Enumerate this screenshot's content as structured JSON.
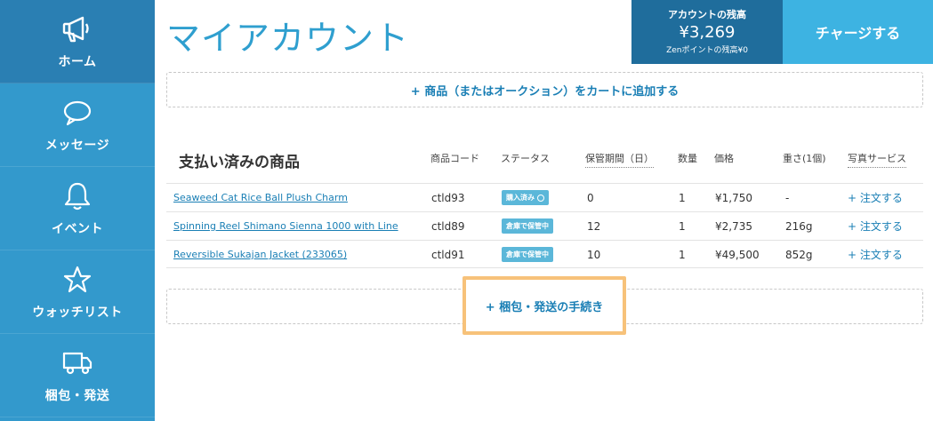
{
  "sidebar": {
    "items": [
      {
        "label": "ホーム",
        "icon": "megaphone-icon",
        "active": true
      },
      {
        "label": "メッセージ",
        "icon": "speech-bubble-icon"
      },
      {
        "label": "イベント",
        "icon": "bell-icon"
      },
      {
        "label": "ウォッチリスト",
        "icon": "star-icon"
      },
      {
        "label": "梱包・発送",
        "icon": "truck-icon"
      }
    ]
  },
  "header": {
    "title": "マイアカウント",
    "balance_label": "アカウントの残高",
    "balance_amount": "¥3,269",
    "points_text": "Zenポイントの残高¥0",
    "charge_label": "チャージする"
  },
  "add_cart_label": "+ 商品（またはオークション）をカートに追加する",
  "paid_items": {
    "title": "支払い済みの商品",
    "columns": {
      "code": "商品コード",
      "status": "ステータス",
      "storage": "保管期間（日）",
      "qty": "数量",
      "price": "価格",
      "weight": "重さ(1個)",
      "photo": "写真サービス"
    },
    "rows": [
      {
        "name": "Seaweed Cat Rice Ball Plush Charm",
        "code": "ctld93",
        "status": "購入済み",
        "storage": "0",
        "qty": "1",
        "price": "¥1,750",
        "weight": "-",
        "photo": "+ 注文する"
      },
      {
        "name": "Spinning Reel Shimano Sienna 1000 with Line",
        "code": "ctld89",
        "status": "倉庫で保管中",
        "storage": "12",
        "qty": "1",
        "price": "¥2,735",
        "weight": "216g",
        "photo": "+ 注文する"
      },
      {
        "name": "Reversible Sukajan Jacket (233065)",
        "code": "ctld91",
        "status": "倉庫で保管中",
        "storage": "10",
        "qty": "1",
        "price": "¥49,500",
        "weight": "852g",
        "photo": "+ 注文する"
      }
    ]
  },
  "ship_label": "+ 梱包・発送の手続き",
  "colors": {
    "sidebar": "#3399cc",
    "sidebar_active": "#2a7fb3",
    "accent": "#2f9fcf",
    "balance_bg": "#1f6d9c",
    "charge_bg": "#3db3e2",
    "highlight": "#f7c27a"
  }
}
